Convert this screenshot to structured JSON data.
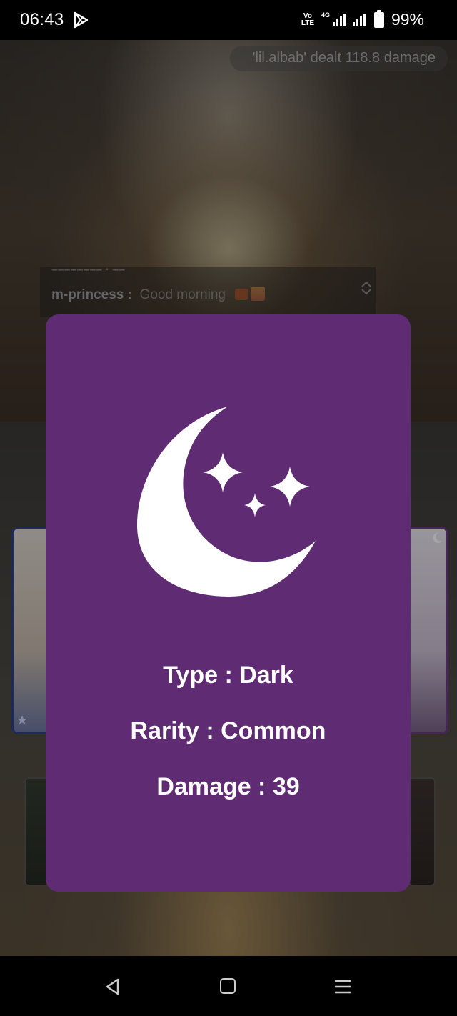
{
  "status_bar": {
    "time": "06:43",
    "volte_line1": "Vo",
    "volte_line2": "LTE",
    "network": "4G",
    "battery_percent": "99%",
    "icons": [
      "play-store-icon",
      "volte-icon",
      "signal-icon",
      "signal-icon",
      "battery-icon"
    ]
  },
  "background": {
    "damage_toast": "'lil.albab' dealt 118.8 damage",
    "chat": {
      "username": "m-princess :",
      "message": "Good morning"
    }
  },
  "modal": {
    "icon": "moon-stars-icon",
    "type_text": "Type : Dark",
    "rarity_text": "Rarity : Common",
    "damage_text": "Damage : 39",
    "background_color": "#5f2b73"
  },
  "nav_bar": {
    "icons": [
      "back-icon",
      "home-icon",
      "recents-menu-icon"
    ]
  }
}
